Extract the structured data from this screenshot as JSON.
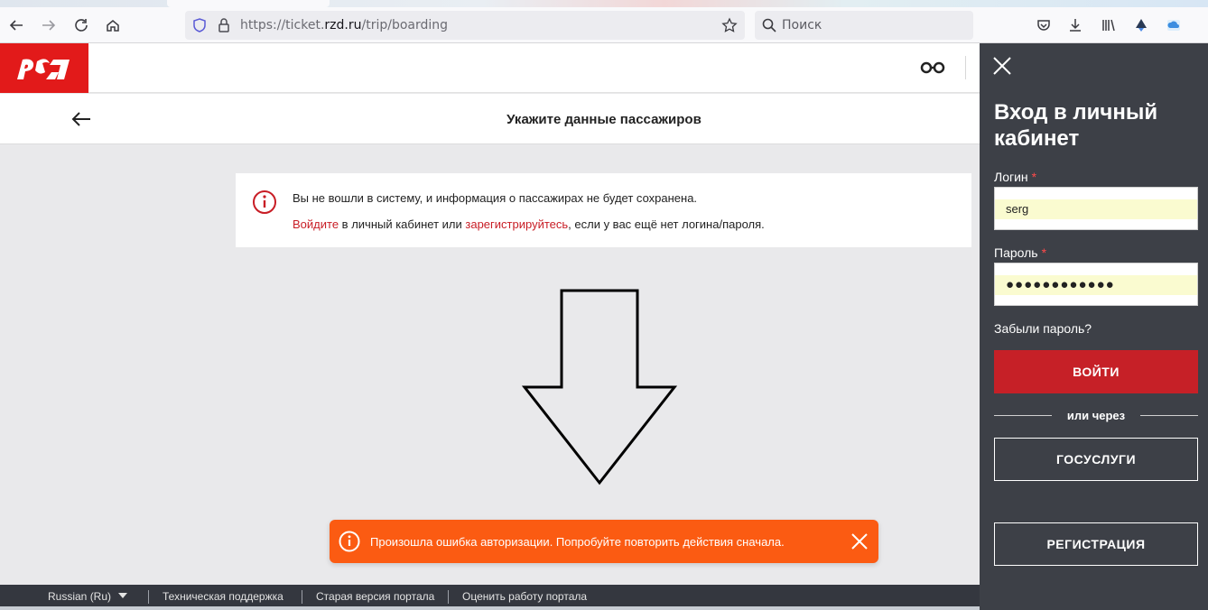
{
  "browser": {
    "url_prefix": "https://ticket.",
    "url_domain": "rzd.ru",
    "url_path": "/trip/boarding",
    "search_placeholder": "Поиск"
  },
  "header": {
    "logo_text": "РЖД"
  },
  "subheader": {
    "title": "Укажите данные пассажиров"
  },
  "notice": {
    "line1": "Вы не вошли в систему, и информация о пассажирах не будет сохранена.",
    "login_link": "Войдите",
    "middle": " в личный кабинет или ",
    "register_link": "зарегистрируйтесь",
    "tail": ", если у вас ещё нет логина/пароля."
  },
  "toast": {
    "message": "Произошла ошибка авторизации. Попробуйте повторить действия сначала."
  },
  "footer": {
    "language": "Russian  (Ru)",
    "support": "Техническая поддержка",
    "old_portal": "Старая версия портала",
    "rate": "Оценить работу портала"
  },
  "login_panel": {
    "title": "Вход в личный кабинет",
    "login_label": "Логин",
    "login_value": "serg",
    "password_label": "Пароль",
    "password_value": "●●●●●●●●●●●●",
    "required_mark": "*",
    "forgot": "Забыли пароль?",
    "login_button": "ВОЙТИ",
    "or_via": "или через",
    "gosuslugi_button": "ГОСУСЛУГИ",
    "register_button": "РЕГИСТРАЦИЯ"
  },
  "colors": {
    "brand_red": "#e21a1a",
    "toast_orange": "#fb5b12",
    "panel_bg": "#3d4047"
  }
}
